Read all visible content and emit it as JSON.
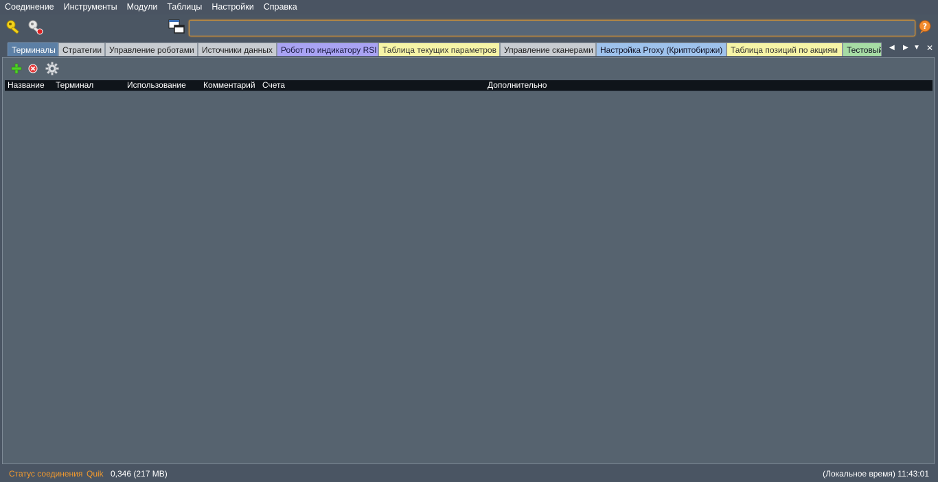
{
  "menu": [
    "Соединение",
    "Инструменты",
    "Модули",
    "Таблицы",
    "Настройки",
    "Справка"
  ],
  "toolbar": {
    "icons": [
      "connect-key-icon",
      "disconnect-key-icon",
      "windows-icon",
      "help-icon"
    ],
    "search_value": ""
  },
  "tabs": [
    {
      "label": "Терминалы",
      "style": "active"
    },
    {
      "label": "Стратегии",
      "style": "gray"
    },
    {
      "label": "Управление роботами",
      "style": "gray"
    },
    {
      "label": "Источники данных",
      "style": "gray"
    },
    {
      "label": "Робот по индикатору RSI",
      "style": "purple"
    },
    {
      "label": "Таблица текущих параметров",
      "style": "yellow"
    },
    {
      "label": "Управление сканерами",
      "style": "gray"
    },
    {
      "label": "Настройка Proxy (Криптобиржи)",
      "style": "blue"
    },
    {
      "label": "Таблица позиций по акциям",
      "style": "yellow"
    },
    {
      "label": "Тестовый",
      "style": "green"
    }
  ],
  "tab_controls": [
    "◀",
    "▶",
    "▼",
    "✕"
  ],
  "panel_toolbar": {
    "icons": [
      "add-icon",
      "delete-icon",
      "settings-gear-icon"
    ]
  },
  "table": {
    "columns": [
      "Название",
      "Терминал",
      "Использование",
      "Комментарий",
      "Счета",
      "Дополнительно"
    ],
    "rows": []
  },
  "status": {
    "connection_label": "Статус соединения",
    "terminal": "Quik",
    "memory": "0,346 (217 MB)",
    "time": "(Локальное время) 11:43:01"
  },
  "colors": {
    "accent_orange": "#f29a2e",
    "search_border": "#e0962c",
    "background": "#4a5563",
    "panel": "#56636f"
  }
}
